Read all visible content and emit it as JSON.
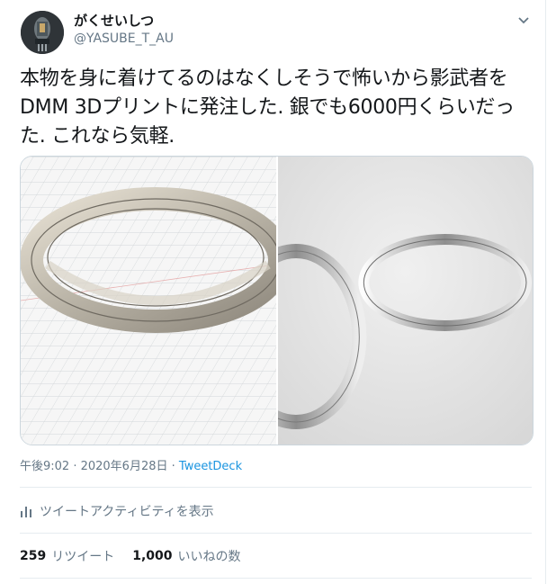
{
  "tweet": {
    "display_name": "がくせいしつ",
    "handle": "@YASUBE_T_AU",
    "text": "本物を身に着けてるのはなくしそうで怖いから影武者をDMM 3Dプリントに発注した. 銀でも6000円くらいだった. これなら気軽.",
    "timestamp": "午後9:02 · 2020年6月28日",
    "separator": " · ",
    "source": "TweetDeck"
  },
  "activity": {
    "label": "ツイートアクティビティを表示",
    "icon": "bar-chart-icon"
  },
  "stats": {
    "retweets_count": "259",
    "retweets_label": "リツイート",
    "likes_count": "1,000",
    "likes_label": "いいねの数"
  },
  "colors": {
    "link": "#1b95e0",
    "secondary_text": "#657786",
    "border": "#e6ecf0"
  },
  "icons": {
    "menu": "chevron-down-icon",
    "activity": "bar-chart-icon"
  }
}
